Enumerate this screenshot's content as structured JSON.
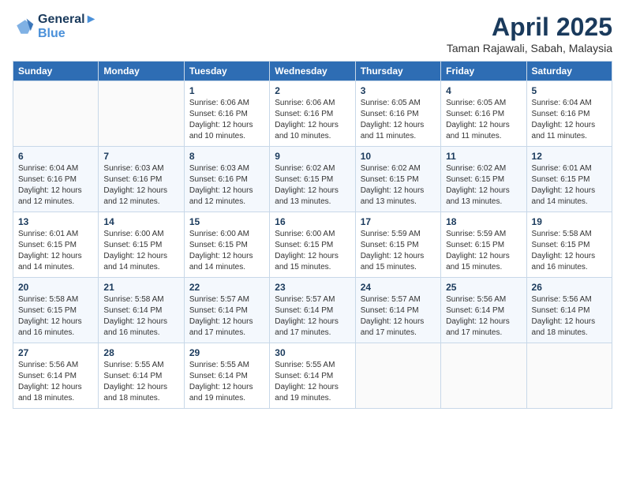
{
  "logo": {
    "line1": "General",
    "line2": "Blue"
  },
  "title": {
    "month_year": "April 2025",
    "location": "Taman Rajawali, Sabah, Malaysia"
  },
  "days_header": [
    "Sunday",
    "Monday",
    "Tuesday",
    "Wednesday",
    "Thursday",
    "Friday",
    "Saturday"
  ],
  "weeks": [
    [
      {
        "day": "",
        "info": ""
      },
      {
        "day": "",
        "info": ""
      },
      {
        "day": "1",
        "info": "Sunrise: 6:06 AM\nSunset: 6:16 PM\nDaylight: 12 hours and 10 minutes."
      },
      {
        "day": "2",
        "info": "Sunrise: 6:06 AM\nSunset: 6:16 PM\nDaylight: 12 hours and 10 minutes."
      },
      {
        "day": "3",
        "info": "Sunrise: 6:05 AM\nSunset: 6:16 PM\nDaylight: 12 hours and 11 minutes."
      },
      {
        "day": "4",
        "info": "Sunrise: 6:05 AM\nSunset: 6:16 PM\nDaylight: 12 hours and 11 minutes."
      },
      {
        "day": "5",
        "info": "Sunrise: 6:04 AM\nSunset: 6:16 PM\nDaylight: 12 hours and 11 minutes."
      }
    ],
    [
      {
        "day": "6",
        "info": "Sunrise: 6:04 AM\nSunset: 6:16 PM\nDaylight: 12 hours and 12 minutes."
      },
      {
        "day": "7",
        "info": "Sunrise: 6:03 AM\nSunset: 6:16 PM\nDaylight: 12 hours and 12 minutes."
      },
      {
        "day": "8",
        "info": "Sunrise: 6:03 AM\nSunset: 6:16 PM\nDaylight: 12 hours and 12 minutes."
      },
      {
        "day": "9",
        "info": "Sunrise: 6:02 AM\nSunset: 6:15 PM\nDaylight: 12 hours and 13 minutes."
      },
      {
        "day": "10",
        "info": "Sunrise: 6:02 AM\nSunset: 6:15 PM\nDaylight: 12 hours and 13 minutes."
      },
      {
        "day": "11",
        "info": "Sunrise: 6:02 AM\nSunset: 6:15 PM\nDaylight: 12 hours and 13 minutes."
      },
      {
        "day": "12",
        "info": "Sunrise: 6:01 AM\nSunset: 6:15 PM\nDaylight: 12 hours and 14 minutes."
      }
    ],
    [
      {
        "day": "13",
        "info": "Sunrise: 6:01 AM\nSunset: 6:15 PM\nDaylight: 12 hours and 14 minutes."
      },
      {
        "day": "14",
        "info": "Sunrise: 6:00 AM\nSunset: 6:15 PM\nDaylight: 12 hours and 14 minutes."
      },
      {
        "day": "15",
        "info": "Sunrise: 6:00 AM\nSunset: 6:15 PM\nDaylight: 12 hours and 14 minutes."
      },
      {
        "day": "16",
        "info": "Sunrise: 6:00 AM\nSunset: 6:15 PM\nDaylight: 12 hours and 15 minutes."
      },
      {
        "day": "17",
        "info": "Sunrise: 5:59 AM\nSunset: 6:15 PM\nDaylight: 12 hours and 15 minutes."
      },
      {
        "day": "18",
        "info": "Sunrise: 5:59 AM\nSunset: 6:15 PM\nDaylight: 12 hours and 15 minutes."
      },
      {
        "day": "19",
        "info": "Sunrise: 5:58 AM\nSunset: 6:15 PM\nDaylight: 12 hours and 16 minutes."
      }
    ],
    [
      {
        "day": "20",
        "info": "Sunrise: 5:58 AM\nSunset: 6:15 PM\nDaylight: 12 hours and 16 minutes."
      },
      {
        "day": "21",
        "info": "Sunrise: 5:58 AM\nSunset: 6:14 PM\nDaylight: 12 hours and 16 minutes."
      },
      {
        "day": "22",
        "info": "Sunrise: 5:57 AM\nSunset: 6:14 PM\nDaylight: 12 hours and 17 minutes."
      },
      {
        "day": "23",
        "info": "Sunrise: 5:57 AM\nSunset: 6:14 PM\nDaylight: 12 hours and 17 minutes."
      },
      {
        "day": "24",
        "info": "Sunrise: 5:57 AM\nSunset: 6:14 PM\nDaylight: 12 hours and 17 minutes."
      },
      {
        "day": "25",
        "info": "Sunrise: 5:56 AM\nSunset: 6:14 PM\nDaylight: 12 hours and 17 minutes."
      },
      {
        "day": "26",
        "info": "Sunrise: 5:56 AM\nSunset: 6:14 PM\nDaylight: 12 hours and 18 minutes."
      }
    ],
    [
      {
        "day": "27",
        "info": "Sunrise: 5:56 AM\nSunset: 6:14 PM\nDaylight: 12 hours and 18 minutes."
      },
      {
        "day": "28",
        "info": "Sunrise: 5:55 AM\nSunset: 6:14 PM\nDaylight: 12 hours and 18 minutes."
      },
      {
        "day": "29",
        "info": "Sunrise: 5:55 AM\nSunset: 6:14 PM\nDaylight: 12 hours and 19 minutes."
      },
      {
        "day": "30",
        "info": "Sunrise: 5:55 AM\nSunset: 6:14 PM\nDaylight: 12 hours and 19 minutes."
      },
      {
        "day": "",
        "info": ""
      },
      {
        "day": "",
        "info": ""
      },
      {
        "day": "",
        "info": ""
      }
    ]
  ]
}
